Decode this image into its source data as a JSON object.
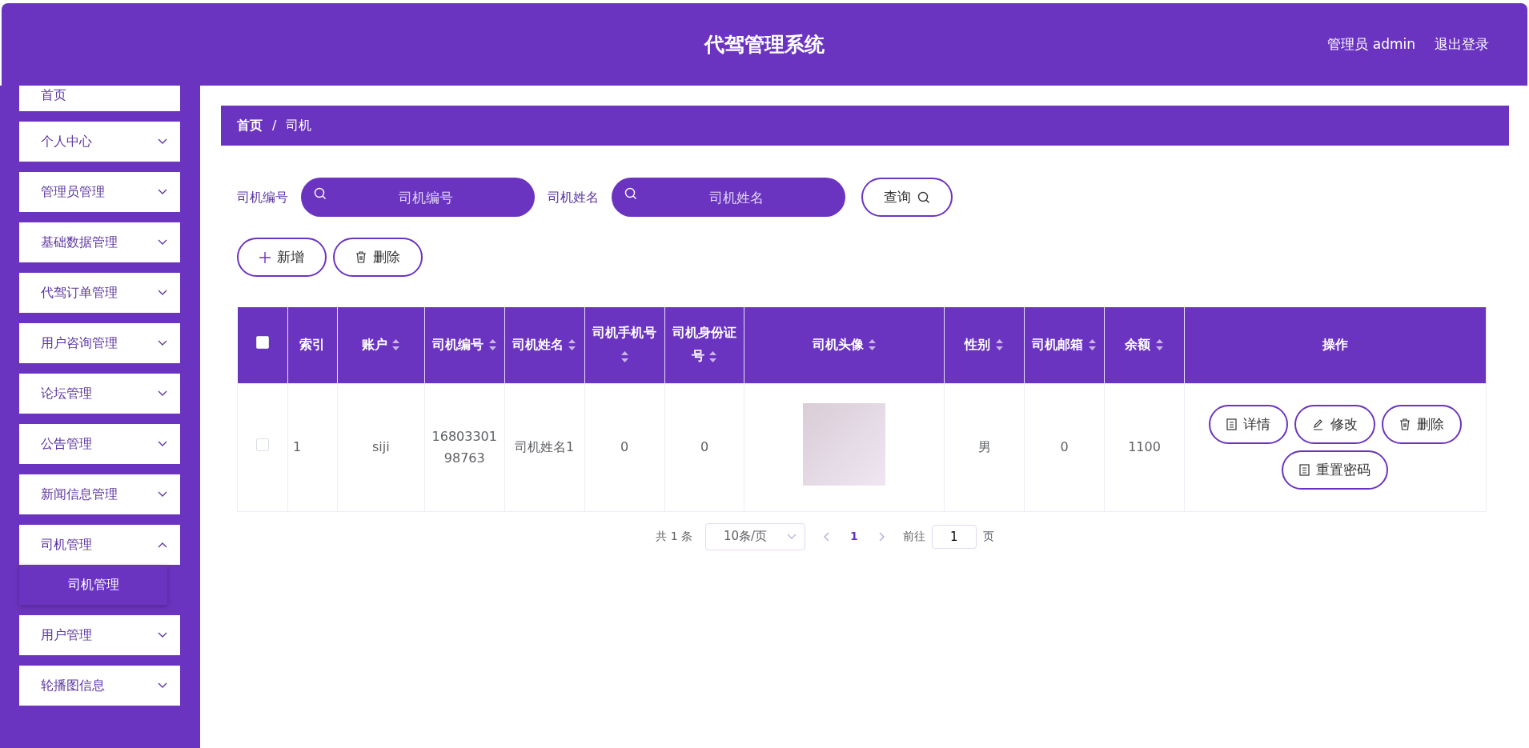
{
  "header": {
    "title": "代驾管理系统",
    "user": "管理员 admin",
    "logout": "退出登录"
  },
  "sidebar": {
    "items": [
      {
        "label": "首页",
        "kind": "link"
      },
      {
        "label": "个人中心",
        "kind": "submenu",
        "expanded": false
      },
      {
        "label": "管理员管理",
        "kind": "submenu",
        "expanded": false
      },
      {
        "label": "基础数据管理",
        "kind": "submenu",
        "expanded": false
      },
      {
        "label": "代驾订单管理",
        "kind": "submenu",
        "expanded": false
      },
      {
        "label": "用户咨询管理",
        "kind": "submenu",
        "expanded": false
      },
      {
        "label": "论坛管理",
        "kind": "submenu",
        "expanded": false
      },
      {
        "label": "公告管理",
        "kind": "submenu",
        "expanded": false
      },
      {
        "label": "新闻信息管理",
        "kind": "submenu",
        "expanded": false
      },
      {
        "label": "司机管理",
        "kind": "submenu",
        "expanded": true,
        "children": [
          {
            "label": "司机管理"
          }
        ]
      },
      {
        "label": "用户管理",
        "kind": "submenu",
        "expanded": false
      },
      {
        "label": "轮播图信息",
        "kind": "submenu",
        "expanded": false
      }
    ]
  },
  "breadcrumb": {
    "items": [
      "首页",
      "司机"
    ],
    "separator": "/"
  },
  "search": {
    "fields": [
      {
        "label": "司机编号",
        "placeholder": "司机编号"
      },
      {
        "label": "司机姓名",
        "placeholder": "司机姓名"
      }
    ],
    "button": "查询"
  },
  "actions": [
    {
      "kind": "add",
      "label": "新增"
    },
    {
      "kind": "delete",
      "label": "删除"
    }
  ],
  "table": {
    "select_all": {
      "checked": false
    },
    "columns": [
      {
        "label": "索引",
        "sortable": false
      },
      {
        "label": "账户",
        "sortable": true
      },
      {
        "label": "司机编号",
        "sortable": true
      },
      {
        "label": "司机姓名",
        "sortable": true
      },
      {
        "label": "司机手机号",
        "sortable": true
      },
      {
        "label": "司机身份证号",
        "sortable": true
      },
      {
        "label": "司机头像",
        "sortable": true
      },
      {
        "label": "性别",
        "sortable": true
      },
      {
        "label": "司机邮箱",
        "sortable": true
      },
      {
        "label": "余额",
        "sortable": true
      },
      {
        "label": "操作",
        "sortable": false
      }
    ],
    "rows": [
      {
        "checked": false,
        "cells": [
          "1",
          "siji",
          "1680330198763",
          "司机姓名1",
          "0",
          "0",
          null,
          "男",
          "0",
          "1100"
        ],
        "buttons": [
          {
            "kind": "detail",
            "label": "详情"
          },
          {
            "kind": "edit",
            "label": "修改"
          },
          {
            "kind": "delete",
            "label": "删除"
          },
          {
            "kind": "detail",
            "label": "重置密码"
          }
        ]
      }
    ]
  },
  "pagination": {
    "total": "共 1 条",
    "page_size": "10条/页",
    "pages": [
      {
        "label": "1",
        "selected": true
      }
    ],
    "goto": "前往",
    "goto_value": "1",
    "page_suffix": "页"
  }
}
